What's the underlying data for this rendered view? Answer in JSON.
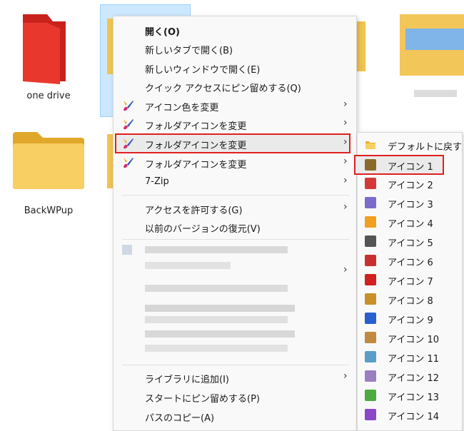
{
  "desktop": {
    "items": [
      {
        "label": "one drive"
      },
      {
        "label": "BackWPup"
      }
    ]
  },
  "menu": {
    "items": [
      {
        "label": "開く(O)"
      },
      {
        "label": "新しいタブで開く(B)"
      },
      {
        "label": "新しいウィンドウで開く(E)"
      },
      {
        "label": "クイック アクセスにピン留めする(Q)"
      },
      {
        "label": "アイコン色を変更",
        "arrow": "›"
      },
      {
        "label": "フォルダアイコンを変更",
        "arrow": "›"
      },
      {
        "label": "フォルダアイコンを変更",
        "arrow": "›"
      },
      {
        "label": "フォルダアイコンを変更",
        "arrow": "›"
      },
      {
        "label": "7-Zip",
        "arrow": "›"
      },
      {
        "label": "アクセスを許可する(G)",
        "arrow": "›"
      },
      {
        "label": "以前のバージョンの復元(V)"
      },
      {
        "label": "",
        "arrow": "›"
      },
      {
        "label": "ライブラリに追加(I)",
        "arrow": "›"
      },
      {
        "label": "スタートにピン留めする(P)"
      },
      {
        "label": "パスのコピー(A)"
      }
    ]
  },
  "submenu": {
    "items": [
      {
        "label": "デフォルトに戻す",
        "icon": "folder-icon",
        "color": "#f2c14e"
      },
      {
        "label": "アイコン 1",
        "icon": "person-icon",
        "color": "#8a6a2a"
      },
      {
        "label": "アイコン 2",
        "icon": "film-icon",
        "color": "#d23a3a"
      },
      {
        "label": "アイコン 3",
        "icon": "purple-folder-icon",
        "color": "#7b6cc9"
      },
      {
        "label": "アイコン 4",
        "icon": "lock-icon",
        "color": "#f0a020"
      },
      {
        "label": "アイコン 5",
        "icon": "tools-icon",
        "color": "#555555"
      },
      {
        "label": "アイコン 6",
        "icon": "media-icon",
        "color": "#c83030"
      },
      {
        "label": "アイコン 7",
        "icon": "plus-icon",
        "color": "#d02020"
      },
      {
        "label": "アイコン 8",
        "icon": "music-icon",
        "color": "#c8902a"
      },
      {
        "label": "アイコン 9",
        "icon": "monitor-icon",
        "color": "#2a5fd0"
      },
      {
        "label": "アイコン 10",
        "icon": "brown-folder-icon",
        "color": "#c08a40"
      },
      {
        "label": "アイコン 11",
        "icon": "teal-folder-icon",
        "color": "#5a9ec8"
      },
      {
        "label": "アイコン 12",
        "icon": "gray-folder-icon",
        "color": "#9a7fc0"
      },
      {
        "label": "アイコン 13",
        "icon": "green-folder-icon",
        "color": "#4caa40"
      },
      {
        "label": "アイコン 14",
        "icon": "violet-folder-icon",
        "color": "#8a48c8"
      }
    ]
  }
}
